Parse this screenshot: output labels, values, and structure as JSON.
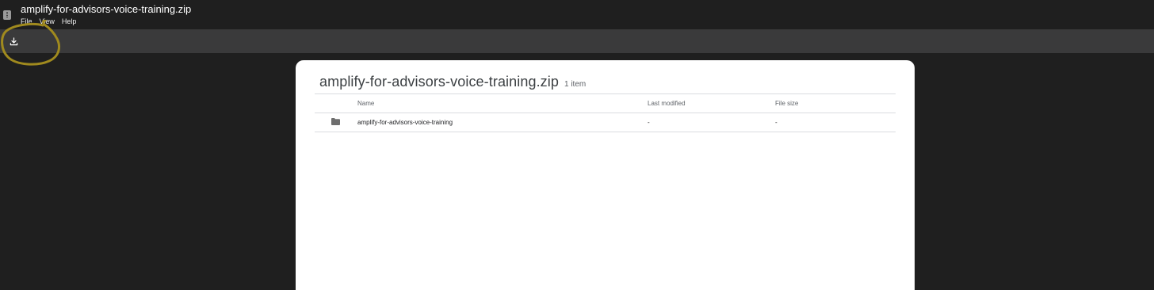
{
  "window": {
    "title": "amplify-for-advisors-voice-training.zip",
    "menu": [
      "File",
      "View",
      "Help"
    ]
  },
  "toolbar": {
    "download_icon": "download-icon"
  },
  "archive": {
    "name": "amplify-for-advisors-voice-training.zip",
    "item_count": "1 item",
    "columns": {
      "name": "Name",
      "last_modified": "Last modified",
      "file_size": "File size"
    },
    "rows": [
      {
        "icon": "folder-icon",
        "name": "amplify-for-advisors-voice-training",
        "last_modified": "-",
        "file_size": "-"
      }
    ]
  },
  "colors": {
    "background": "#1f1f1f",
    "toolbar": "#3a3a3b",
    "card": "#ffffff",
    "annotation": "#a08a1e"
  }
}
